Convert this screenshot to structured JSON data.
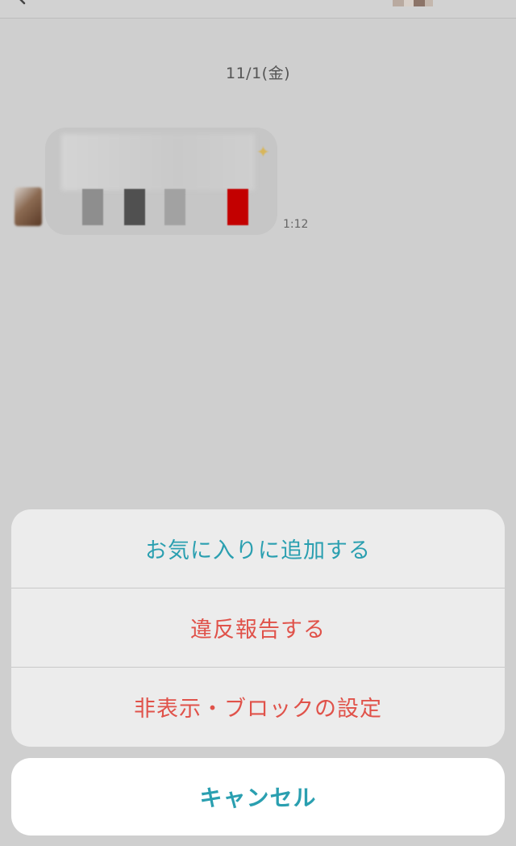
{
  "chat": {
    "date": "11/1(金)",
    "message_time": "1:12"
  },
  "action_sheet": {
    "options": [
      {
        "label": "お気に入りに追加する",
        "color": "#2a9fb0"
      },
      {
        "label": "違反報告する",
        "color": "#e0524a"
      },
      {
        "label": "非表示・ブロックの設定",
        "color": "#e0524a"
      }
    ],
    "cancel_label": "キャンセル",
    "cancel_color": "#2a9fb0"
  }
}
